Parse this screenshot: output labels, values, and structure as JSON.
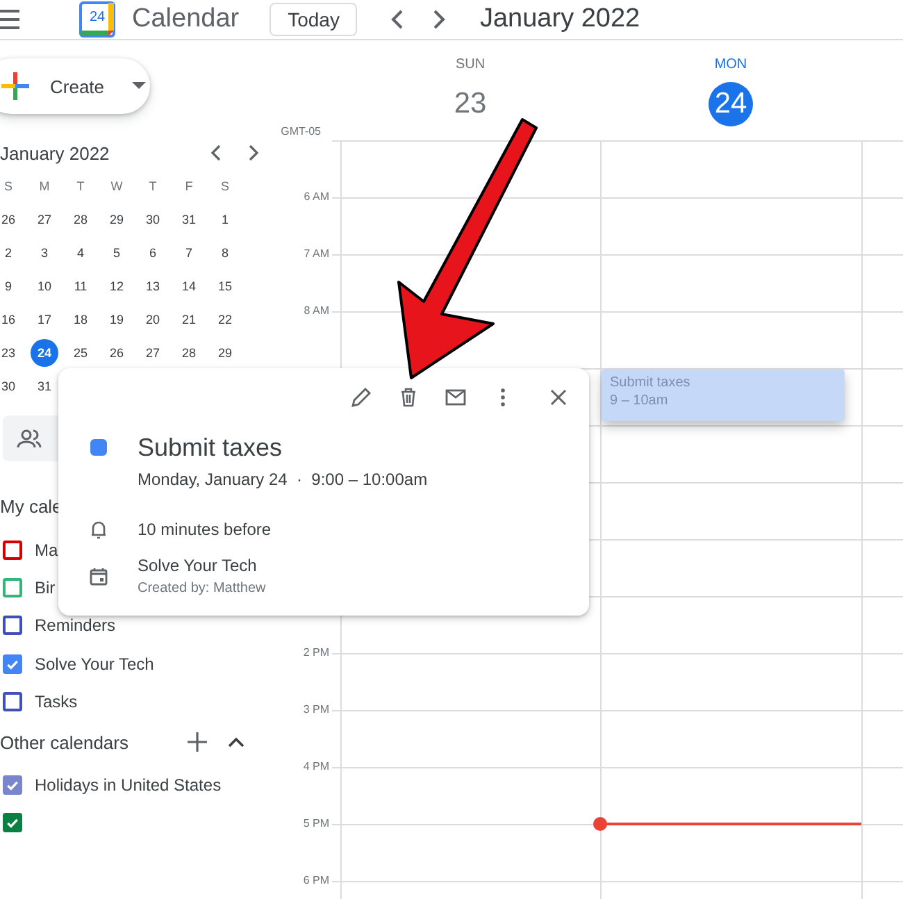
{
  "header": {
    "app_title": "Calendar",
    "logo_day": "24",
    "today_button": "Today",
    "month_title": "January 2022"
  },
  "sidebar": {
    "create_button": "Create",
    "mini_calendar": {
      "title": "January 2022",
      "weekdays": [
        "S",
        "M",
        "T",
        "W",
        "T",
        "F",
        "S"
      ],
      "weeks": [
        [
          {
            "d": "26",
            "selected": false
          },
          {
            "d": "27",
            "selected": false
          },
          {
            "d": "28",
            "selected": false
          },
          {
            "d": "29",
            "selected": false
          },
          {
            "d": "30",
            "selected": false
          },
          {
            "d": "31",
            "selected": false
          },
          {
            "d": "1",
            "selected": false
          }
        ],
        [
          {
            "d": "2",
            "selected": false
          },
          {
            "d": "3",
            "selected": false
          },
          {
            "d": "4",
            "selected": false
          },
          {
            "d": "5",
            "selected": false
          },
          {
            "d": "6",
            "selected": false
          },
          {
            "d": "7",
            "selected": false
          },
          {
            "d": "8",
            "selected": false
          }
        ],
        [
          {
            "d": "9",
            "selected": false
          },
          {
            "d": "10",
            "selected": false
          },
          {
            "d": "11",
            "selected": false
          },
          {
            "d": "12",
            "selected": false
          },
          {
            "d": "13",
            "selected": false
          },
          {
            "d": "14",
            "selected": false
          },
          {
            "d": "15",
            "selected": false
          }
        ],
        [
          {
            "d": "16",
            "selected": false
          },
          {
            "d": "17",
            "selected": false
          },
          {
            "d": "18",
            "selected": false
          },
          {
            "d": "19",
            "selected": false
          },
          {
            "d": "20",
            "selected": false
          },
          {
            "d": "21",
            "selected": false
          },
          {
            "d": "22",
            "selected": false
          }
        ],
        [
          {
            "d": "23",
            "selected": false
          },
          {
            "d": "24",
            "selected": true
          },
          {
            "d": "25",
            "selected": false
          },
          {
            "d": "26",
            "selected": false
          },
          {
            "d": "27",
            "selected": false
          },
          {
            "d": "28",
            "selected": false
          },
          {
            "d": "29",
            "selected": false
          }
        ],
        [
          {
            "d": "30",
            "selected": false
          },
          {
            "d": "31",
            "selected": false
          }
        ]
      ]
    },
    "my_calendars": {
      "title": "My cale",
      "items": [
        {
          "label": "Ma",
          "checked": false,
          "color": "#d50000"
        },
        {
          "label": "Bir",
          "checked": false,
          "color": "#33b679"
        },
        {
          "label": "Reminders",
          "checked": false,
          "color": "#3f51b5"
        },
        {
          "label": "Solve Your Tech",
          "checked": true,
          "color": "#4285f4"
        },
        {
          "label": "Tasks",
          "checked": false,
          "color": "#3f51b5"
        }
      ]
    },
    "other_calendars": {
      "title": "Other calendars",
      "items": [
        {
          "label": "Holidays in United States",
          "checked": true,
          "color": "#7986cb"
        },
        {
          "checked": true,
          "color": "#0b8043"
        }
      ]
    }
  },
  "days": [
    {
      "weekday": "SUN",
      "date": "23",
      "selected": false
    },
    {
      "weekday": "MON",
      "date": "24",
      "selected": true
    }
  ],
  "timezone": "GMT-05",
  "hour_rows": [
    {},
    {
      "label": "6 AM"
    },
    {
      "label": "7 AM"
    },
    {
      "label": "8 AM"
    },
    {
      "event": {
        "title": "Submit taxes",
        "time": "9 – 10am"
      }
    },
    {},
    {},
    {},
    {},
    {
      "label": "2 PM"
    },
    {
      "label": "3 PM"
    },
    {
      "label": "4 PM"
    },
    {
      "label": "5 PM",
      "now": true
    },
    {
      "label": "6 PM"
    }
  ],
  "popover": {
    "title": "Submit taxes",
    "color": "#4285f4",
    "when": "Monday, January 24  ·  9:00 – 10:00am",
    "reminder": "10 minutes before",
    "calendar": "Solve Your Tech",
    "created_by": "Created by: Matthew"
  }
}
